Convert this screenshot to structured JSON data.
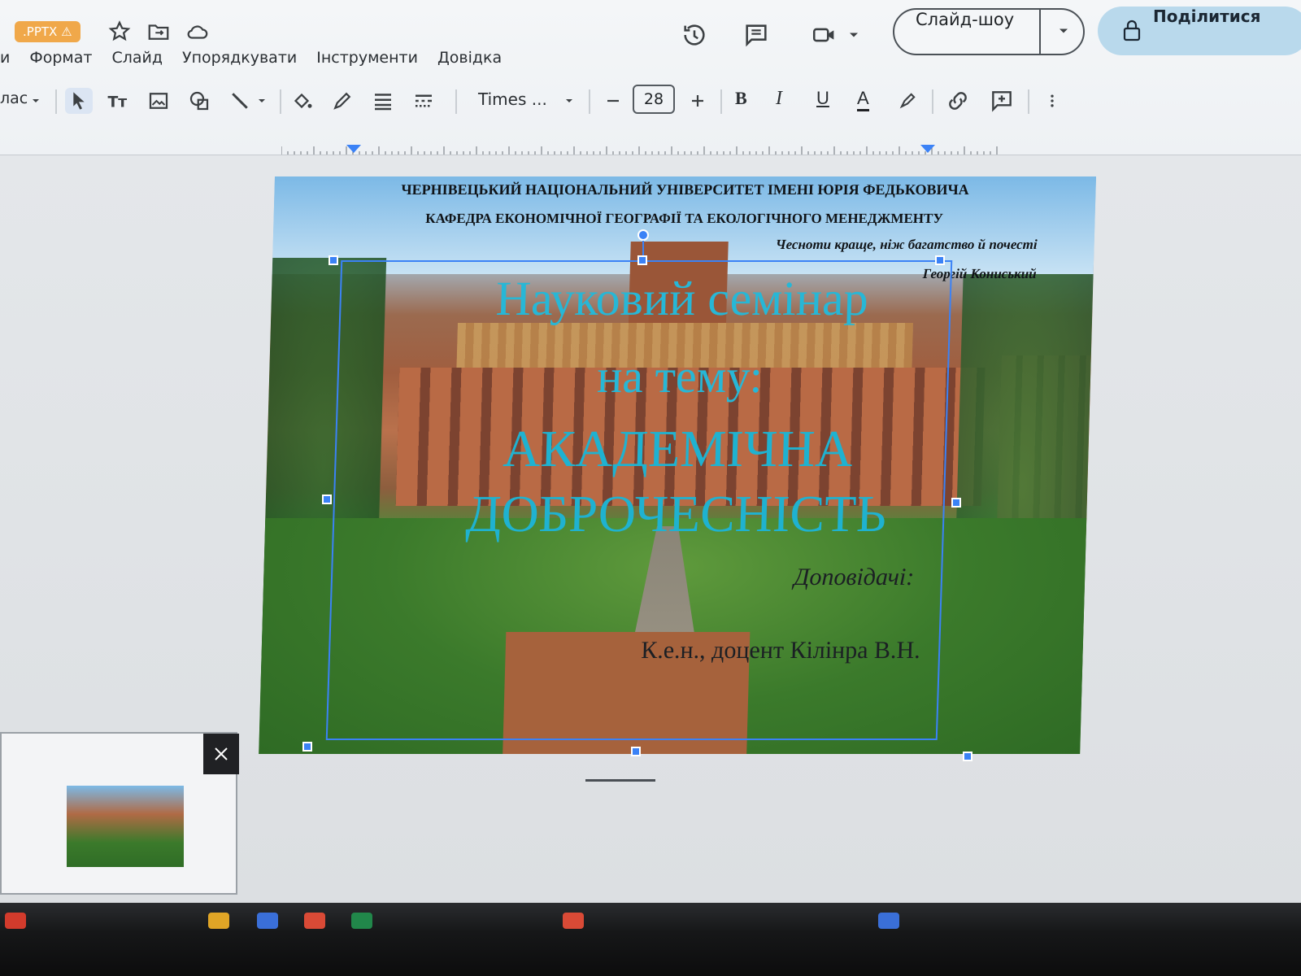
{
  "file_badge": ".PPTX",
  "menu": {
    "partial_first": "и",
    "items": [
      "Формат",
      "Слайд",
      "Упорядкувати",
      "Інструменти",
      "Довідка"
    ]
  },
  "header": {
    "slideshow_label": "Слайд-шоу",
    "share_label": "Поділитися"
  },
  "toolbar": {
    "partial_label": "лас",
    "font_name": "Times ...",
    "font_size": "28",
    "bold": "B",
    "italic": "I",
    "underline": "U",
    "text_color": "A"
  },
  "slide": {
    "university": "ЧЕРНІВЕЦЬКИЙ НАЦІОНАЛЬНИЙ УНІВЕРСИТЕТ ІМЕНІ ЮРІЯ ФЕДЬКОВИЧА",
    "department": "КАФЕДРА ЕКОНОМІЧНОЇ ГЕОГРАФІЇ ТА ЕКОЛОГІЧНОГО МЕНЕДЖМЕНТУ",
    "quote": "Чесноти краще, ніж багатство й почесті",
    "quote_author": "Георгій Кониський",
    "title_line1": "Науковий семінар",
    "title_line2": "на тему:",
    "title_line3": "АКАДЕМІЧНА",
    "title_line4": "ДОБРОЧЕСНІСТЬ",
    "speaker_label": "Доповідачі:",
    "speaker": "К.е.н., доцент Кілінра В.Н."
  },
  "colors": {
    "accent": "#3b82f6",
    "title_text": "#27b7d6",
    "share_button": "#b9d9ec",
    "pptx_badge": "#f0a84a"
  }
}
